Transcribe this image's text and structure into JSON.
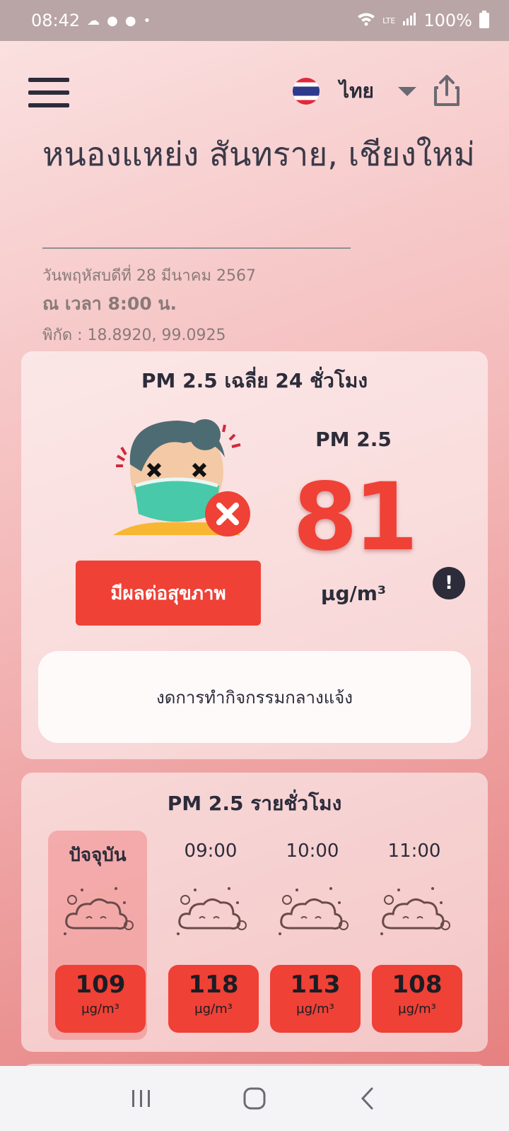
{
  "status_bar": {
    "time": "08:42",
    "battery": "100%",
    "network": "LTE"
  },
  "header": {
    "language": "ไทย"
  },
  "location": {
    "title": "หนองแหย่ง สันทราย, เชียงใหม่",
    "date": "วันพฤหัสบดีที่ 28 มีนาคม 2567",
    "time": "ณ เวลา 8:00 น.",
    "coordinates": "พิกัด : 18.8920, 99.0925"
  },
  "daily_card": {
    "title": "PM 2.5 เฉลี่ย 24 ชั่วโมง",
    "health_button": "มีผลต่อสุขภาพ",
    "pm_label": "PM 2.5",
    "pm_value": "81",
    "unit": "µg/m³",
    "info_icon": "!",
    "advice": "งดการทำกิจกรรมกลางแจ้ง"
  },
  "hourly_card": {
    "title": "PM 2.5 รายชั่วโมง",
    "hours": [
      {
        "label": "ปัจจุบัน",
        "value": "109",
        "unit": "µg/m³"
      },
      {
        "label": "09:00",
        "value": "118",
        "unit": "µg/m³"
      },
      {
        "label": "10:00",
        "value": "113",
        "unit": "µg/m³"
      },
      {
        "label": "11:00",
        "value": "108",
        "unit": "µg/m³"
      }
    ]
  },
  "icons": [
    "menu-icon",
    "thai-flag-icon",
    "caret-down-icon",
    "share-icon",
    "masked-face-icon",
    "info-icon",
    "haze-cloud-icon",
    "nav-recents-icon",
    "nav-home-icon",
    "nav-back-icon"
  ],
  "colors": {
    "alert_red": "#ef4136",
    "text_dark": "#2c2c3a"
  }
}
